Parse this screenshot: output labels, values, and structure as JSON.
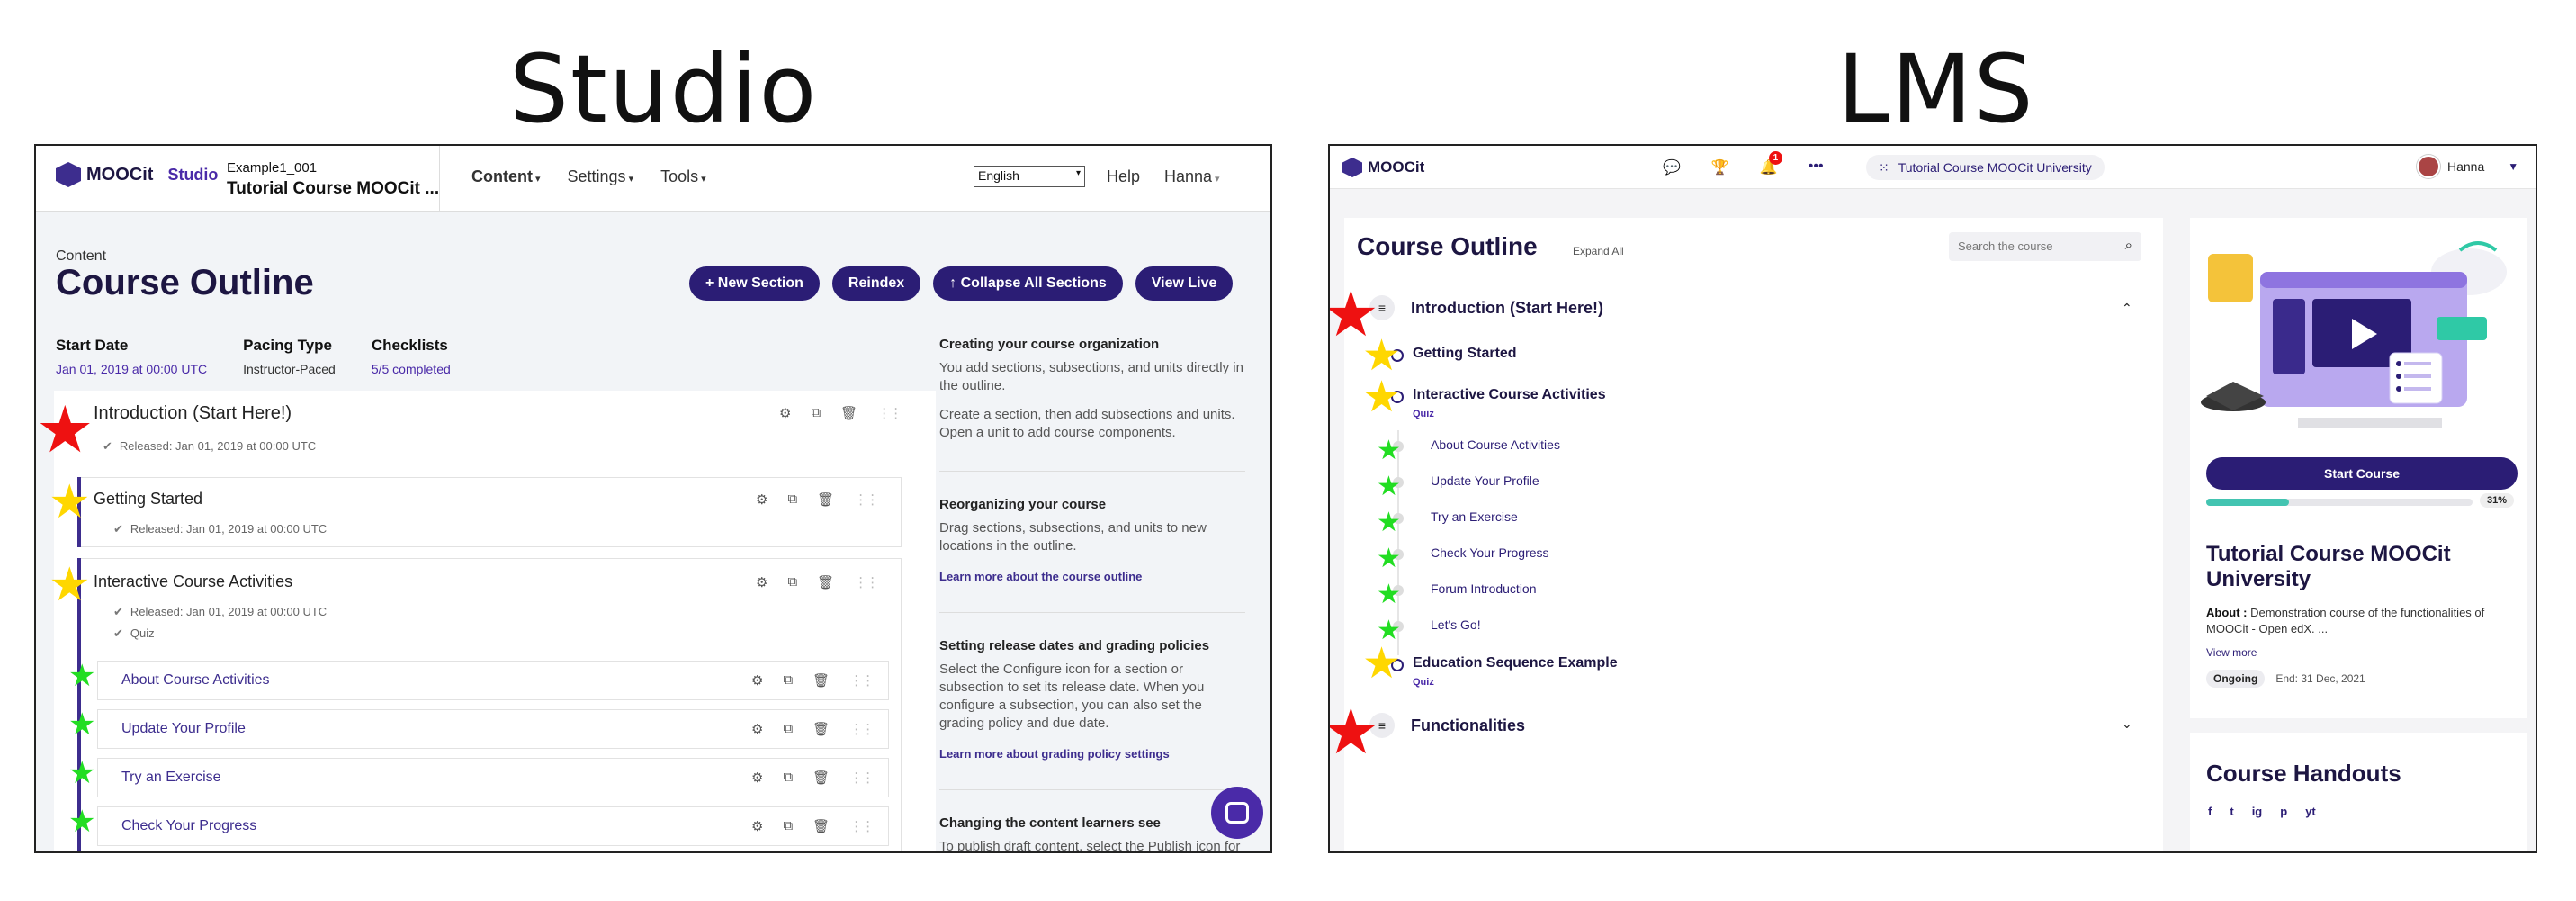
{
  "headings": {
    "studio": "Studio",
    "lms": "LMS"
  },
  "studio": {
    "logo_text": "MOOCit",
    "logo_sub": "Studio",
    "course_number": "Example1_001",
    "course_title": "Tutorial Course MOOCit ...",
    "nav": [
      "Content",
      "Settings",
      "Tools"
    ],
    "language": "English",
    "help": "Help",
    "user": "Hanna",
    "breadcrumb": "Content",
    "page_title": "Course Outline",
    "buttons": [
      "+ New Section",
      "Reindex",
      "↑ Collapse All Sections",
      "View Live"
    ],
    "stats": [
      {
        "label": "Start Date",
        "value": "Jan 01, 2019 at 00:00 UTC"
      },
      {
        "label": "Pacing Type",
        "value": "Instructor-Paced"
      },
      {
        "label": "Checklists",
        "value": "5/5 completed"
      }
    ],
    "section_title": "Introduction (Start Here!)",
    "section_released": "Released: Jan 01, 2019 at 00:00 UTC",
    "subsections": [
      {
        "title": "Getting Started",
        "released": "Released: Jan 01, 2019 at 00:00 UTC"
      },
      {
        "title": "Interactive Course Activities",
        "released": "Released: Jan 01, 2019 at 00:00 UTC",
        "tag": "Quiz"
      }
    ],
    "units": [
      "About Course Activities",
      "Update Your Profile",
      "Try an Exercise",
      "Check Your Progress"
    ],
    "sidebar": {
      "block1_head": "Creating your course organization",
      "block1_p1": "You add sections, subsections, and units directly in the outline.",
      "block1_p2": "Create a section, then add subsections and units. Open a unit to add course components.",
      "block2_head": "Reorganizing your course",
      "block2_p1": "Drag sections, subsections, and units to new locations in the outline.",
      "block2_link": "Learn more about the course outline",
      "block3_head": "Setting release dates and grading policies",
      "block3_p1": "Select the Configure icon for a section or subsection to set its release date. When you configure a subsection, you can also set the grading policy and due date.",
      "block3_link": "Learn more about grading policy settings",
      "block4_head": "Changing the content learners see",
      "block4_p1": "To publish draft content, select the Publish icon for a section, subsection, or unit."
    }
  },
  "lms": {
    "logo_text": "MOOCit",
    "notification_count": "1",
    "course_chip": "Tutorial Course MOOCit University",
    "user": "Hanna",
    "page_title": "Course Outline",
    "expand_all": "Expand All",
    "search_placeholder": "Search the course",
    "sections": [
      "Introduction (Start Here!)",
      "Functionalities"
    ],
    "subsections": [
      {
        "title": "Getting Started"
      },
      {
        "title": "Interactive Course Activities",
        "tag": "Quiz"
      },
      {
        "title": "Education Sequence Example",
        "tag": "Quiz"
      }
    ],
    "units": [
      "About Course Activities",
      "Update Your Profile",
      "Try an Exercise",
      "Check Your Progress",
      "Forum Introduction",
      "Let's Go!"
    ],
    "card": {
      "start_button": "Start Course",
      "progress_pct": "31%",
      "progress_value": 0.31,
      "course_title": "Tutorial Course MOOCit University",
      "about_label": "About :",
      "about_text": "Demonstration course of the functionalities of MOOCit - Open edX. ...",
      "view_more": "View more",
      "status": "Ongoing",
      "end": "End: 31 Dec, 2021"
    },
    "handouts_title": "Course Handouts",
    "social": [
      "f",
      "t",
      "ig",
      "p",
      "yt"
    ]
  },
  "colors": {
    "brand": "#2b1d75",
    "accent": "#4a2aa8",
    "progress": "#43c4b1",
    "star_red": "#ee1111",
    "star_yellow": "#ffd700",
    "star_green": "#22dd22"
  }
}
